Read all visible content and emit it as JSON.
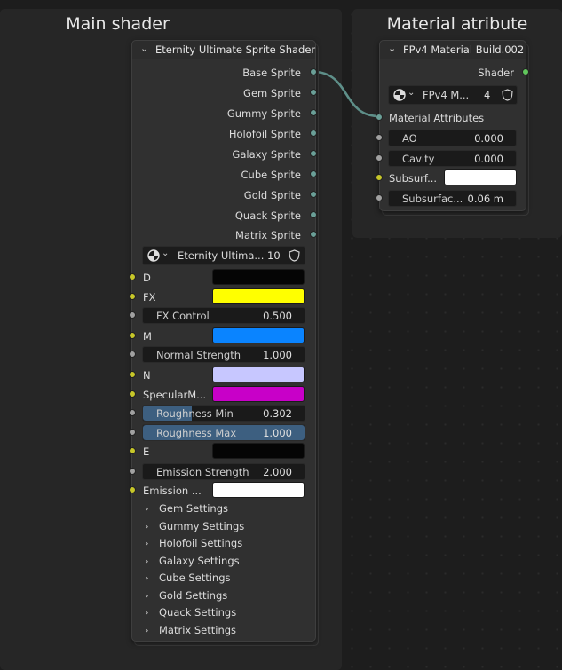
{
  "frames": {
    "main_title": "Main shader",
    "material_title": "Material atribute"
  },
  "node_main": {
    "title": "Eternity Ultimate Sprite Shader",
    "outputs": [
      "Base Sprite",
      "Gem Sprite",
      "Gummy Sprite",
      "Holofoil Sprite",
      "Galaxy Sprite",
      "Cube Sprite",
      "Gold Sprite",
      "Quack Sprite",
      "Matrix Sprite"
    ],
    "group_name": "Eternity Ultima...",
    "group_users": "10",
    "inputs": {
      "d_label": "D",
      "d_color": "#050505",
      "fx_label": "FX",
      "fx_color": "#ffff00",
      "fx_control_label": "FX Control",
      "fx_control_value": "0.500",
      "m_label": "M",
      "m_color": "#0a84ff",
      "normal_strength_label": "Normal Strength",
      "normal_strength_value": "1.000",
      "n_label": "N",
      "n_color": "#c7c7ff",
      "specular_label": "SpecularM...",
      "specular_color": "#c800c8",
      "rough_min_label": "Roughness Min",
      "rough_min_value": "0.302",
      "rough_min_fill": 0.302,
      "rough_max_label": "Roughness Max",
      "rough_max_value": "1.000",
      "rough_max_fill": 1.0,
      "e_label": "E",
      "e_color": "#050505",
      "emission_strength_label": "Emission Strength",
      "emission_strength_value": "2.000",
      "emission_label": "Emission ...",
      "emission_color": "#ffffff"
    },
    "panels": [
      "Gem Settings",
      "Gummy Settings",
      "Holofoil Settings",
      "Galaxy Settings",
      "Cube Settings",
      "Gold Settings",
      "Quack Settings",
      "Matrix Settings"
    ]
  },
  "node_material": {
    "title": "FPv4 Material Build.002",
    "output_label": "Shader",
    "group_name": "FPv4 M...",
    "group_users": "4",
    "input_label": "Material Attributes",
    "ao_label": "AO",
    "ao_value": "0.000",
    "cavity_label": "Cavity",
    "cavity_value": "0.000",
    "subsurface_label": "Subsurf...",
    "subsurface_color": "#ffffff",
    "subsurface_radius_label": "Subsurfac...",
    "subsurface_radius_value": "0.06 m"
  },
  "colors": {
    "socket_shader": "#61c65c",
    "socket_float": "#a1a1a1",
    "socket_color": "#c7c729",
    "socket_material": "#6a9f97",
    "slider_fill": "#3d5f80",
    "link": "#5e8f89"
  }
}
